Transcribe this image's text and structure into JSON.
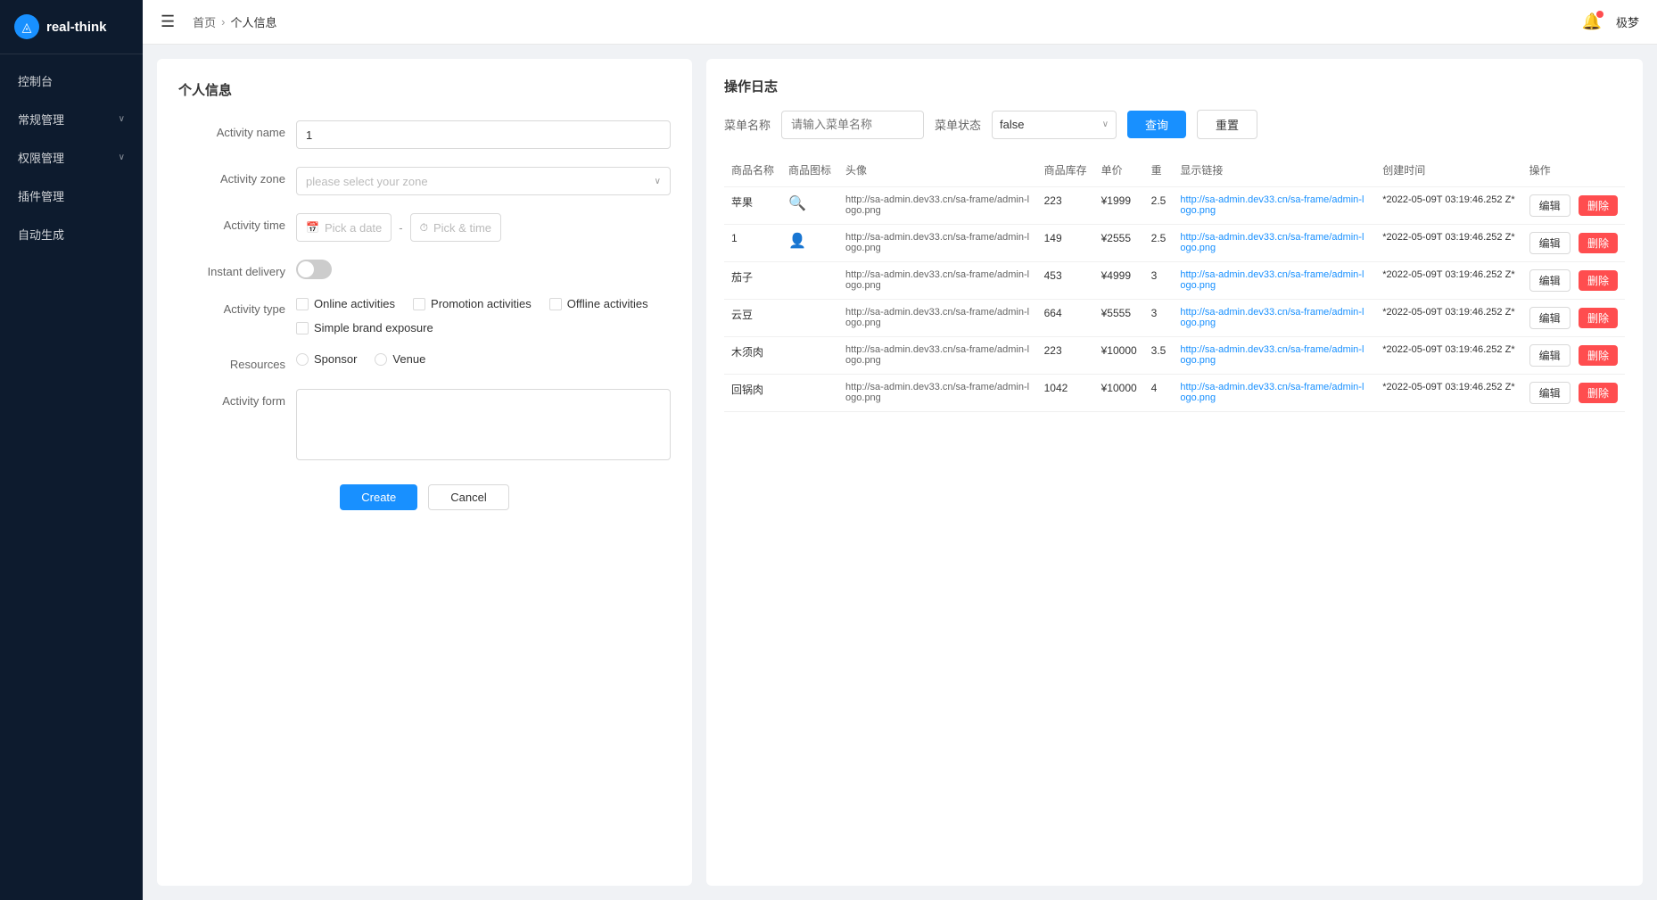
{
  "sidebar": {
    "logo": {
      "icon": "◬",
      "text": "real-think"
    },
    "nav": [
      {
        "id": "dashboard",
        "label": "控制台",
        "hasChildren": false
      },
      {
        "id": "routine",
        "label": "常规管理",
        "hasChildren": true
      },
      {
        "id": "permission",
        "label": "权限管理",
        "hasChildren": true
      },
      {
        "id": "plugin",
        "label": "插件管理",
        "hasChildren": false
      },
      {
        "id": "autogen",
        "label": "自动生成",
        "hasChildren": false
      }
    ]
  },
  "topbar": {
    "hamburger": "☰",
    "breadcrumb": [
      "首页",
      "个人信息"
    ],
    "username": "极梦"
  },
  "left_panel": {
    "title": "个人信息",
    "form": {
      "activity_name_label": "Activity name",
      "activity_name_value": "1",
      "activity_zone_label": "Activity zone",
      "activity_zone_placeholder": "please select your zone",
      "activity_time_label": "Activity time",
      "pick_a_date": "Pick a date",
      "pick_a_time": "Pick & time",
      "instant_delivery_label": "Instant delivery",
      "activity_type_label": "Activity type",
      "activity_type_options": [
        {
          "id": "online",
          "label": "Online activities"
        },
        {
          "id": "promotion",
          "label": "Promotion activities"
        },
        {
          "id": "offline",
          "label": "Offline activities"
        },
        {
          "id": "brand",
          "label": "Simple brand exposure"
        }
      ],
      "resources_label": "Resources",
      "resources_options": [
        {
          "id": "sponsor",
          "label": "Sponsor"
        },
        {
          "id": "venue",
          "label": "Venue"
        }
      ],
      "activity_form_label": "Activity form",
      "create_btn": "Create",
      "cancel_btn": "Cancel"
    }
  },
  "right_panel": {
    "title": "操作日志",
    "filter": {
      "menu_name_label": "菜单名称",
      "menu_name_placeholder": "请输入菜单名称",
      "menu_status_label": "菜单状态",
      "menu_status_value": "false",
      "query_btn": "查询",
      "reset_btn": "重置"
    },
    "table": {
      "columns": [
        "商品名称",
        "商品图标",
        "头像",
        "商品库存",
        "单价",
        "重",
        "显示链接",
        "创建时间",
        "操作"
      ],
      "rows": [
        {
          "name": "苹果",
          "icon": "search",
          "avatar": "http://sa-admin.dev33.cn/sa-frame/admin-logo.png",
          "stock": "223",
          "price": "¥1999",
          "weight": "2.5",
          "link": "http://sa-admin.dev33.cn/sa-frame/admin-logo.png",
          "created": "*2022-05-09T 03:19:46.252 Z*"
        },
        {
          "name": "1",
          "icon": "user",
          "avatar": "http://sa-admin.dev33.cn/sa-frame/admin-logo.png",
          "stock": "149",
          "price": "¥2555",
          "weight": "2.5",
          "link": "http://sa-admin.dev33.cn/sa-frame/admin-logo.png",
          "created": "*2022-05-09T 03:19:46.252 Z*"
        },
        {
          "name": "茄子",
          "icon": "",
          "avatar": "http://sa-admin.dev33.cn/sa-frame/admin-logo.png",
          "stock": "453",
          "price": "¥4999",
          "weight": "3",
          "link": "http://sa-admin.dev33.cn/sa-frame/admin-logo.png",
          "created": "*2022-05-09T 03:19:46.252 Z*"
        },
        {
          "name": "云豆",
          "icon": "",
          "avatar": "http://sa-admin.dev33.cn/sa-frame/admin-logo.png",
          "stock": "664",
          "price": "¥5555",
          "weight": "3",
          "link": "http://sa-admin.dev33.cn/sa-frame/admin-logo.png",
          "created": "*2022-05-09T 03:19:46.252 Z*"
        },
        {
          "name": "木须肉",
          "icon": "",
          "avatar": "http://sa-admin.dev33.cn/sa-frame/admin-logo.png",
          "stock": "223",
          "price": "¥10000",
          "weight": "3.5",
          "link": "http://sa-admin.dev33.cn/sa-frame/admin-logo.png",
          "created": "*2022-05-09T 03:19:46.252 Z*"
        },
        {
          "name": "回锅肉",
          "icon": "",
          "avatar": "http://sa-admin.dev33.cn/sa-frame/admin-logo.png",
          "stock": "1042",
          "price": "¥10000",
          "weight": "4",
          "link": "http://sa-admin.dev33.cn/sa-frame/admin-logo.png",
          "created": "*2022-05-09T 03:19:46.252 Z*"
        }
      ],
      "edit_btn": "编辑",
      "delete_btn": "删除"
    }
  }
}
